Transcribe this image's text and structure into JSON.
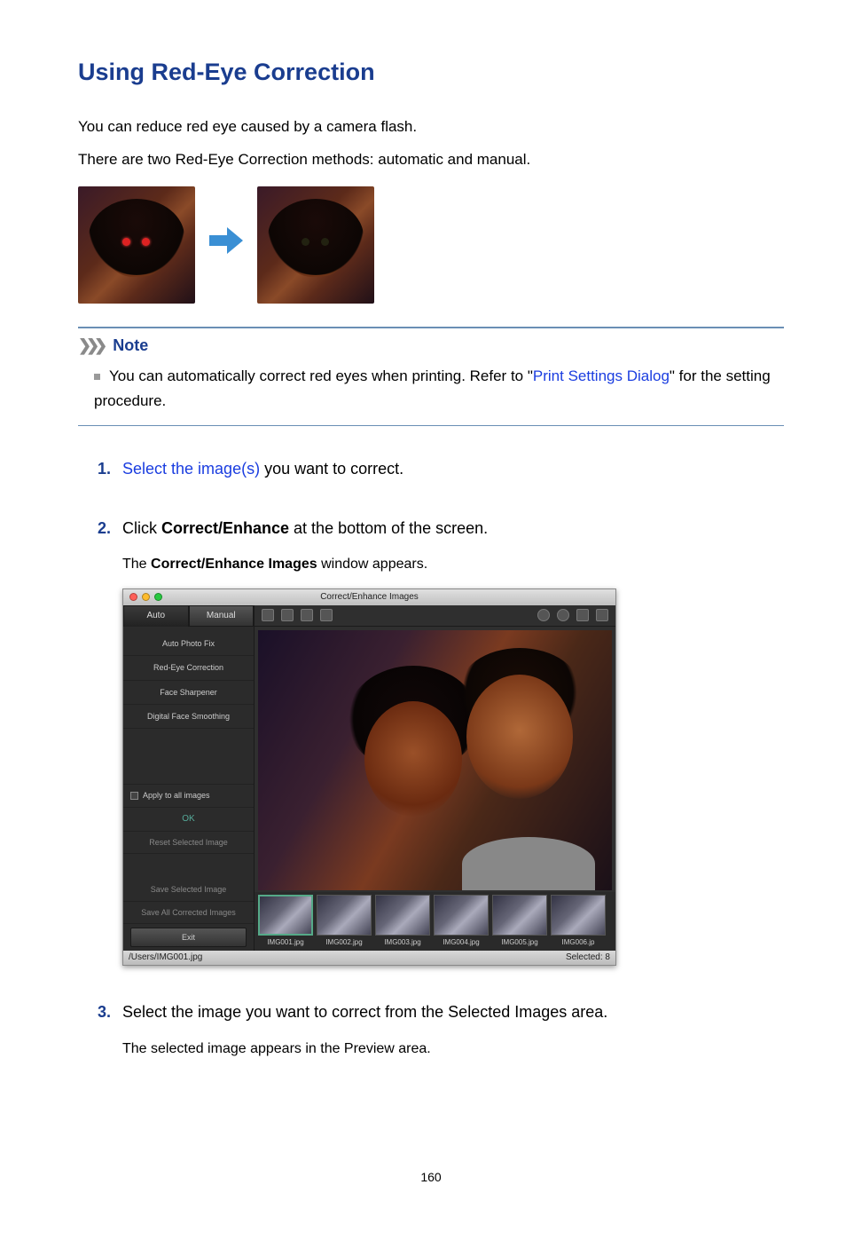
{
  "title": "Using Red-Eye Correction",
  "intro1": "You can reduce red eye caused by a camera flash.",
  "intro2": "There are two Red-Eye Correction methods: automatic and manual.",
  "note": {
    "label": "Note",
    "text_before": "You can automatically correct red eyes when printing. Refer to \"",
    "link": "Print Settings Dialog",
    "text_after": "\" for the setting procedure."
  },
  "steps": {
    "s1_link": "Select the image(s)",
    "s1_rest": " you want to correct.",
    "s2_a": "Click ",
    "s2_bold": "Correct/Enhance",
    "s2_b": " at the bottom of the screen.",
    "s2_sub_a": "The ",
    "s2_sub_bold": "Correct/Enhance Images",
    "s2_sub_b": " window appears.",
    "s3": "Select the image you want to correct from the Selected Images area.",
    "s3_sub": "The selected image appears in the Preview area."
  },
  "app": {
    "window_title": "Correct/Enhance Images",
    "tab_auto": "Auto",
    "tab_manual": "Manual",
    "side": {
      "auto_photo_fix": "Auto Photo Fix",
      "red_eye": "Red-Eye Correction",
      "face_sharpener": "Face Sharpener",
      "digital_face": "Digital Face Smoothing",
      "apply_all": "Apply to all images",
      "ok": "OK",
      "reset": "Reset Selected Image",
      "save_selected": "Save Selected Image",
      "save_all": "Save All Corrected Images",
      "exit": "Exit"
    },
    "thumbs": [
      "IMG001.jpg",
      "IMG002.jpg",
      "IMG003.jpg",
      "IMG004.jpg",
      "IMG005.jpg",
      "IMG006.jp"
    ],
    "status_path": "/Users/IMG001.jpg",
    "status_selected": "Selected: 8"
  },
  "page_number": "160"
}
